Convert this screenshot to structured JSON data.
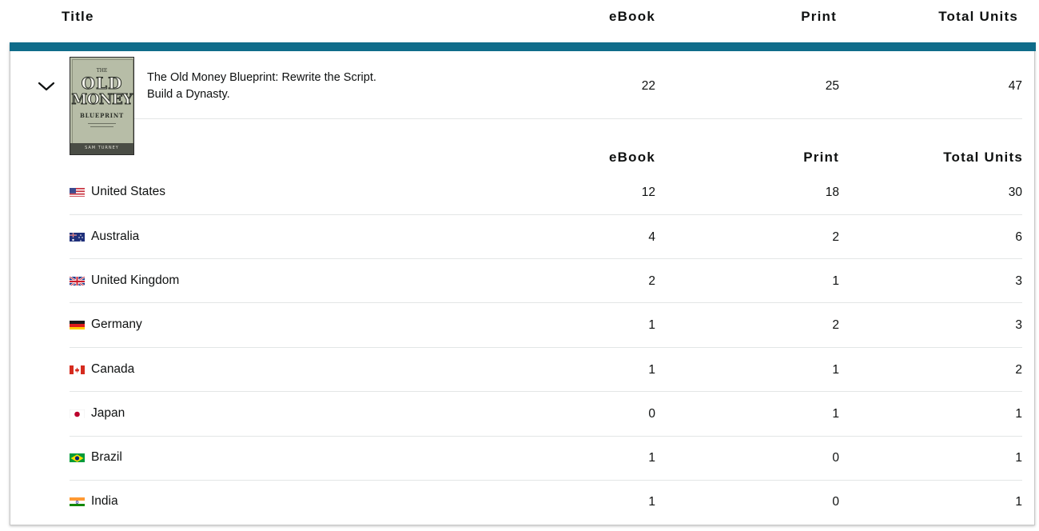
{
  "header": {
    "title_col": "Title",
    "ebook_col": "eBook",
    "print_col": "Print",
    "total_col": "Total Units"
  },
  "book": {
    "title_line1": "The Old Money Blueprint: Rewrite the Script.",
    "title_line2": "Build a Dynasty.",
    "ebook": "22",
    "print": "25",
    "total": "47",
    "cover": {
      "the": "THE",
      "old": "OLD",
      "money": "MONEY",
      "blueprint": "BLUEPRINT",
      "author": "SAM TURNEY"
    }
  },
  "sub_header": {
    "ebook_col": "eBook",
    "print_col": "Print",
    "total_col": "Total Units"
  },
  "countries": [
    {
      "name": "United States",
      "ebook": "12",
      "print": "18",
      "total": "30",
      "flag": "us-flag"
    },
    {
      "name": "Australia",
      "ebook": "4",
      "print": "2",
      "total": "6",
      "flag": "au-flag"
    },
    {
      "name": "United Kingdom",
      "ebook": "2",
      "print": "1",
      "total": "3",
      "flag": "uk-flag"
    },
    {
      "name": "Germany",
      "ebook": "1",
      "print": "2",
      "total": "3",
      "flag": "de-flag"
    },
    {
      "name": "Canada",
      "ebook": "1",
      "print": "1",
      "total": "2",
      "flag": "ca-flag"
    },
    {
      "name": "Japan",
      "ebook": "0",
      "print": "1",
      "total": "1",
      "flag": "jp-flag"
    },
    {
      "name": "Brazil",
      "ebook": "1",
      "print": "0",
      "total": "1",
      "flag": "br-flag"
    },
    {
      "name": "India",
      "ebook": "1",
      "print": "0",
      "total": "1",
      "flag": "in-flag"
    }
  ],
  "colors": {
    "accent_bar": "#0f6c8a",
    "divider": "#e3e6e6",
    "text": "#0f1111"
  }
}
